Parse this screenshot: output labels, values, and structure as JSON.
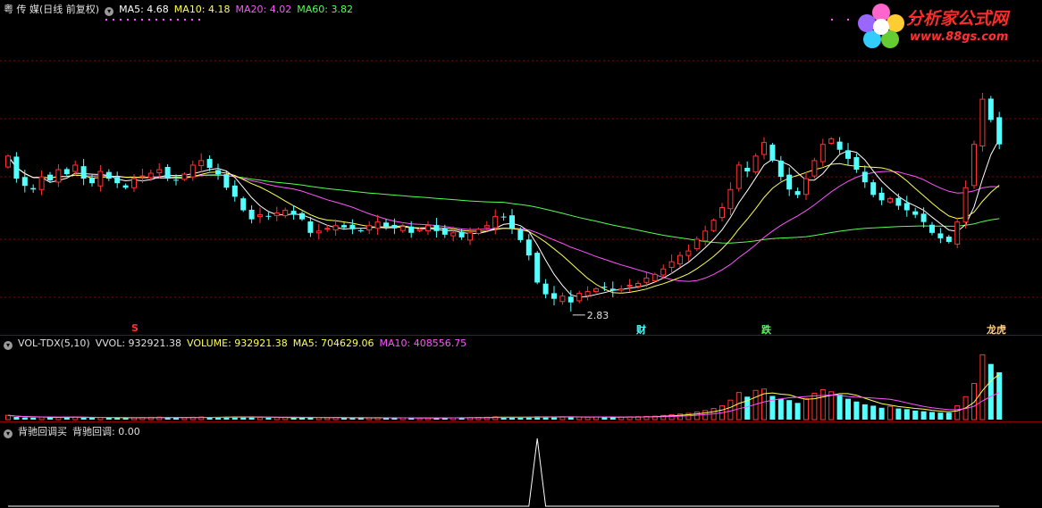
{
  "colors": {
    "up": "#ff3232",
    "down": "#54ffff",
    "ma5": "#ffffff",
    "ma10": "#ffff54",
    "ma20": "#ff54ff",
    "ma60": "#54ff54",
    "grid": "#8b0000",
    "white": "#e0e0e0",
    "cyan_text": "#54ffff"
  },
  "price_header": {
    "title": "粤 传 媒(日线 前复权)",
    "ma5_label": "MA5: 4.68",
    "ma10_label": "MA10: 4.18",
    "ma20_label": "MA20: 4.02",
    "ma60_label": "MA60: 3.82"
  },
  "volume_header": {
    "name": "VOL-TDX(5,10)",
    "vvol": "VVOL: 932921.38",
    "volume": "VOLUME: 932921.38",
    "ma5": "MA5: 704629.06",
    "ma10": "MA10: 408556.75"
  },
  "indicator_header": {
    "name": "背驰回调买",
    "value": "背驰回调: 0.00"
  },
  "annotations": {
    "low_label": "2.83",
    "event_cai": "财",
    "event_die": "跌",
    "event_longhu": "龙虎",
    "event_s": "S"
  },
  "logo": {
    "title": "分析家公式网",
    "url": "www.88gs.com"
  },
  "chart_data": [
    {
      "type": "candlestick",
      "title": "粤 传 媒(日线 前复权)",
      "series_names": [
        "MA5",
        "MA10",
        "MA20",
        "MA60"
      ],
      "last_values": {
        "MA5": 4.68,
        "MA10": 4.18,
        "MA20": 4.02,
        "MA60": 3.82
      },
      "ylim": [
        2.7,
        6.1
      ],
      "annotation_low": 2.83,
      "close": [
        4.55,
        4.3,
        4.22,
        4.18,
        4.32,
        4.28,
        4.4,
        4.35,
        4.45,
        4.3,
        4.25,
        4.38,
        4.3,
        4.25,
        4.2,
        4.3,
        4.33,
        4.36,
        4.4,
        4.3,
        4.28,
        4.35,
        4.45,
        4.5,
        4.42,
        4.35,
        4.2,
        4.1,
        3.95,
        3.85,
        3.9,
        3.88,
        3.92,
        3.95,
        3.9,
        3.85,
        3.7,
        3.72,
        3.75,
        3.78,
        3.76,
        3.74,
        3.72,
        3.78,
        3.82,
        3.77,
        3.75,
        3.77,
        3.7,
        3.74,
        3.78,
        3.72,
        3.68,
        3.7,
        3.65,
        3.7,
        3.74,
        3.78,
        3.88,
        3.87,
        3.75,
        3.62,
        3.45,
        3.15,
        3.02,
        2.97,
        3.0,
        2.93,
        3.03,
        3.05,
        3.08,
        3.1,
        3.06,
        3.08,
        3.12,
        3.14,
        3.2,
        3.24,
        3.3,
        3.38,
        3.45,
        3.5,
        3.63,
        3.72,
        3.84,
        3.98,
        4.18,
        4.45,
        4.38,
        4.55,
        4.7,
        4.5,
        4.32,
        4.18,
        4.12,
        4.3,
        4.5,
        4.68,
        4.74,
        4.62,
        4.52,
        4.4,
        4.26,
        4.12,
        4.06,
        4.08,
        4.0,
        3.95,
        3.9,
        3.82,
        3.7,
        3.64,
        3.6,
        3.82,
        4.2,
        4.68,
        5.18,
        4.95,
        4.68
      ],
      "volume": [
        62000,
        38000,
        30000,
        28000,
        36000,
        34000,
        32000,
        35000,
        38000,
        30000,
        28000,
        30000,
        27000,
        25000,
        24000,
        26000,
        30000,
        33000,
        36000,
        28000,
        26000,
        28000,
        34000,
        38000,
        32000,
        36000,
        40000,
        42000,
        40000,
        36000,
        30000,
        28000,
        30000,
        32000,
        28000,
        30000,
        34000,
        30000,
        28000,
        30000,
        26000,
        24000,
        24000,
        26000,
        28000,
        26000,
        24000,
        26000,
        24000,
        22000,
        24000,
        26000,
        28000,
        26000,
        28000,
        30000,
        32000,
        34000,
        40000,
        36000,
        34000,
        30000,
        40000,
        46000,
        40000,
        38000,
        36000,
        40000,
        38000,
        36000,
        38000,
        36000,
        34000,
        36000,
        40000,
        42000,
        46000,
        50000,
        60000,
        72000,
        80000,
        90000,
        110000,
        130000,
        160000,
        200000,
        280000,
        390000,
        330000,
        420000,
        440000,
        340000,
        300000,
        280000,
        240000,
        300000,
        380000,
        430000,
        400000,
        360000,
        300000,
        260000,
        220000,
        200000,
        170000,
        190000,
        160000,
        150000,
        130000,
        120000,
        110000,
        100000,
        100000,
        200000,
        330000,
        520000,
        932921,
        800000,
        680000
      ],
      "volume_header": {
        "VVOL": 932921.38,
        "VOLUME": 932921.38,
        "MA5": 704629.06,
        "MA10": 408556.75
      }
    },
    {
      "type": "line",
      "title": "背驰回调买",
      "series_names": [
        "背驰回调"
      ],
      "last_value": 0.0,
      "spike_index": 63,
      "values_note": "0 everywhere except a single spike"
    }
  ]
}
